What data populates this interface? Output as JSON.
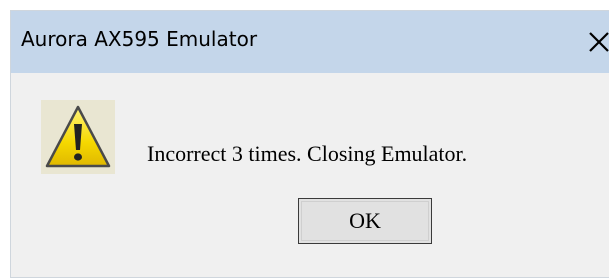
{
  "dialog": {
    "title": "Aurora AX595 Emulator",
    "close_icon": "close-icon",
    "warning_icon": "warning-icon",
    "message": "Incorrect 3 times. Closing Emulator.",
    "ok_label": "OK"
  },
  "colors": {
    "titlebar": "#c4d6ea",
    "body": "#f0f0f0",
    "warning_fill": "#f5d800",
    "button_face": "#e1e1e1"
  }
}
